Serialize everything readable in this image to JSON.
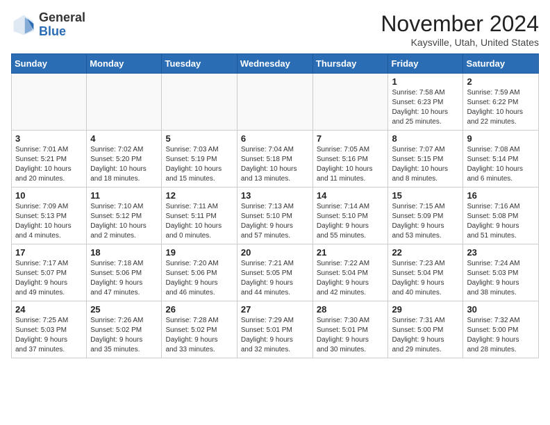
{
  "logo": {
    "general": "General",
    "blue": "Blue"
  },
  "title": "November 2024",
  "location": "Kaysville, Utah, United States",
  "days_of_week": [
    "Sunday",
    "Monday",
    "Tuesday",
    "Wednesday",
    "Thursday",
    "Friday",
    "Saturday"
  ],
  "weeks": [
    [
      {
        "day": "",
        "info": ""
      },
      {
        "day": "",
        "info": ""
      },
      {
        "day": "",
        "info": ""
      },
      {
        "day": "",
        "info": ""
      },
      {
        "day": "",
        "info": ""
      },
      {
        "day": "1",
        "info": "Sunrise: 7:58 AM\nSunset: 6:23 PM\nDaylight: 10 hours\nand 25 minutes."
      },
      {
        "day": "2",
        "info": "Sunrise: 7:59 AM\nSunset: 6:22 PM\nDaylight: 10 hours\nand 22 minutes."
      }
    ],
    [
      {
        "day": "3",
        "info": "Sunrise: 7:01 AM\nSunset: 5:21 PM\nDaylight: 10 hours\nand 20 minutes."
      },
      {
        "day": "4",
        "info": "Sunrise: 7:02 AM\nSunset: 5:20 PM\nDaylight: 10 hours\nand 18 minutes."
      },
      {
        "day": "5",
        "info": "Sunrise: 7:03 AM\nSunset: 5:19 PM\nDaylight: 10 hours\nand 15 minutes."
      },
      {
        "day": "6",
        "info": "Sunrise: 7:04 AM\nSunset: 5:18 PM\nDaylight: 10 hours\nand 13 minutes."
      },
      {
        "day": "7",
        "info": "Sunrise: 7:05 AM\nSunset: 5:16 PM\nDaylight: 10 hours\nand 11 minutes."
      },
      {
        "day": "8",
        "info": "Sunrise: 7:07 AM\nSunset: 5:15 PM\nDaylight: 10 hours\nand 8 minutes."
      },
      {
        "day": "9",
        "info": "Sunrise: 7:08 AM\nSunset: 5:14 PM\nDaylight: 10 hours\nand 6 minutes."
      }
    ],
    [
      {
        "day": "10",
        "info": "Sunrise: 7:09 AM\nSunset: 5:13 PM\nDaylight: 10 hours\nand 4 minutes."
      },
      {
        "day": "11",
        "info": "Sunrise: 7:10 AM\nSunset: 5:12 PM\nDaylight: 10 hours\nand 2 minutes."
      },
      {
        "day": "12",
        "info": "Sunrise: 7:11 AM\nSunset: 5:11 PM\nDaylight: 10 hours\nand 0 minutes."
      },
      {
        "day": "13",
        "info": "Sunrise: 7:13 AM\nSunset: 5:10 PM\nDaylight: 9 hours\nand 57 minutes."
      },
      {
        "day": "14",
        "info": "Sunrise: 7:14 AM\nSunset: 5:10 PM\nDaylight: 9 hours\nand 55 minutes."
      },
      {
        "day": "15",
        "info": "Sunrise: 7:15 AM\nSunset: 5:09 PM\nDaylight: 9 hours\nand 53 minutes."
      },
      {
        "day": "16",
        "info": "Sunrise: 7:16 AM\nSunset: 5:08 PM\nDaylight: 9 hours\nand 51 minutes."
      }
    ],
    [
      {
        "day": "17",
        "info": "Sunrise: 7:17 AM\nSunset: 5:07 PM\nDaylight: 9 hours\nand 49 minutes."
      },
      {
        "day": "18",
        "info": "Sunrise: 7:18 AM\nSunset: 5:06 PM\nDaylight: 9 hours\nand 47 minutes."
      },
      {
        "day": "19",
        "info": "Sunrise: 7:20 AM\nSunset: 5:06 PM\nDaylight: 9 hours\nand 46 minutes."
      },
      {
        "day": "20",
        "info": "Sunrise: 7:21 AM\nSunset: 5:05 PM\nDaylight: 9 hours\nand 44 minutes."
      },
      {
        "day": "21",
        "info": "Sunrise: 7:22 AM\nSunset: 5:04 PM\nDaylight: 9 hours\nand 42 minutes."
      },
      {
        "day": "22",
        "info": "Sunrise: 7:23 AM\nSunset: 5:04 PM\nDaylight: 9 hours\nand 40 minutes."
      },
      {
        "day": "23",
        "info": "Sunrise: 7:24 AM\nSunset: 5:03 PM\nDaylight: 9 hours\nand 38 minutes."
      }
    ],
    [
      {
        "day": "24",
        "info": "Sunrise: 7:25 AM\nSunset: 5:03 PM\nDaylight: 9 hours\nand 37 minutes."
      },
      {
        "day": "25",
        "info": "Sunrise: 7:26 AM\nSunset: 5:02 PM\nDaylight: 9 hours\nand 35 minutes."
      },
      {
        "day": "26",
        "info": "Sunrise: 7:28 AM\nSunset: 5:02 PM\nDaylight: 9 hours\nand 33 minutes."
      },
      {
        "day": "27",
        "info": "Sunrise: 7:29 AM\nSunset: 5:01 PM\nDaylight: 9 hours\nand 32 minutes."
      },
      {
        "day": "28",
        "info": "Sunrise: 7:30 AM\nSunset: 5:01 PM\nDaylight: 9 hours\nand 30 minutes."
      },
      {
        "day": "29",
        "info": "Sunrise: 7:31 AM\nSunset: 5:00 PM\nDaylight: 9 hours\nand 29 minutes."
      },
      {
        "day": "30",
        "info": "Sunrise: 7:32 AM\nSunset: 5:00 PM\nDaylight: 9 hours\nand 28 minutes."
      }
    ]
  ]
}
